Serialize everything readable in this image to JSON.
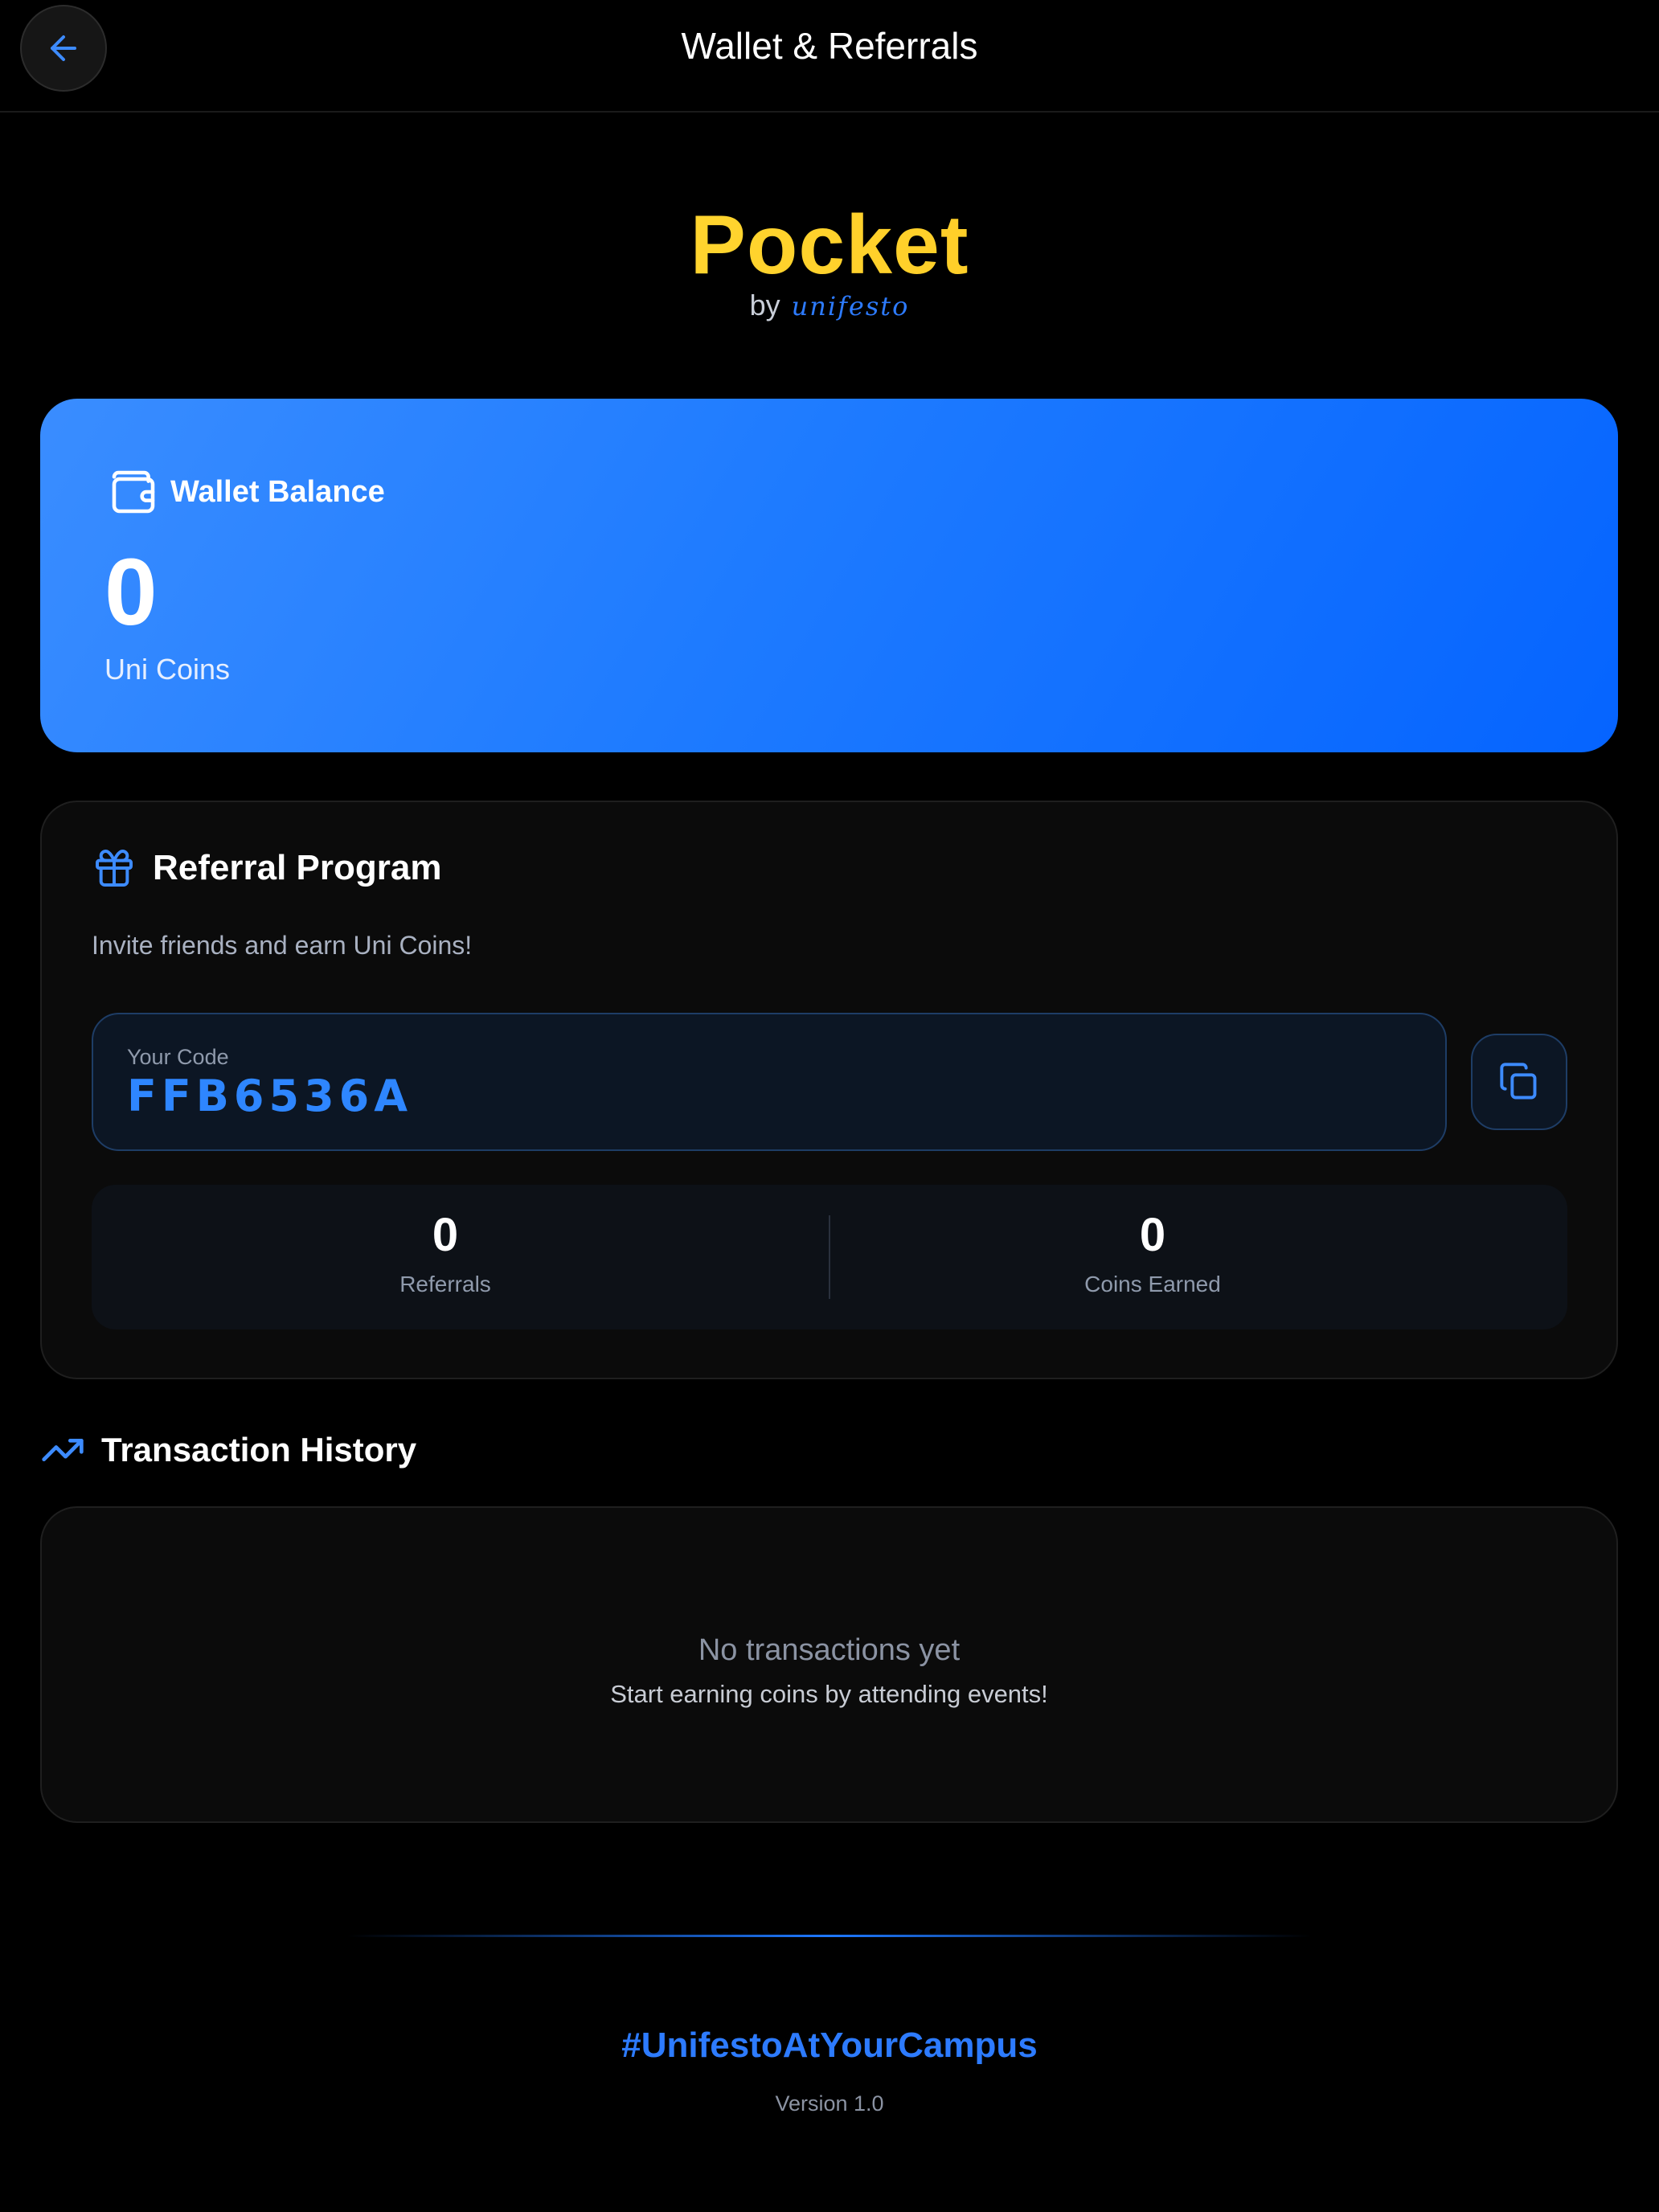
{
  "header": {
    "title": "Wallet & Referrals",
    "back_icon": "arrow-left-icon"
  },
  "logo": {
    "word": "Pocket",
    "by": "by",
    "brand": "unifesto"
  },
  "wallet": {
    "label": "Wallet Balance",
    "amount": "0",
    "unit": "Uni Coins",
    "icon": "wallet-icon"
  },
  "referral": {
    "title": "Referral Program",
    "description": "Invite friends and earn Uni Coins!",
    "code_label": "Your Code",
    "code_value": "FFB6536A",
    "copy_icon": "copy-icon",
    "gift_icon": "gift-icon",
    "stats": {
      "referrals_value": "0",
      "referrals_label": "Referrals",
      "coins_value": "0",
      "coins_label": "Coins Earned"
    }
  },
  "transactions": {
    "title": "Transaction History",
    "icon": "trending-up-icon",
    "empty_title": "No transactions yet",
    "empty_subtitle": "Start earning coins by attending events!"
  },
  "footer": {
    "hashtag": "#UnifestoAtYourCampus",
    "version": "Version 1.0"
  },
  "colors": {
    "accent": "#2d7bff",
    "logo_yellow": "#ffc21a",
    "background": "#000000"
  }
}
